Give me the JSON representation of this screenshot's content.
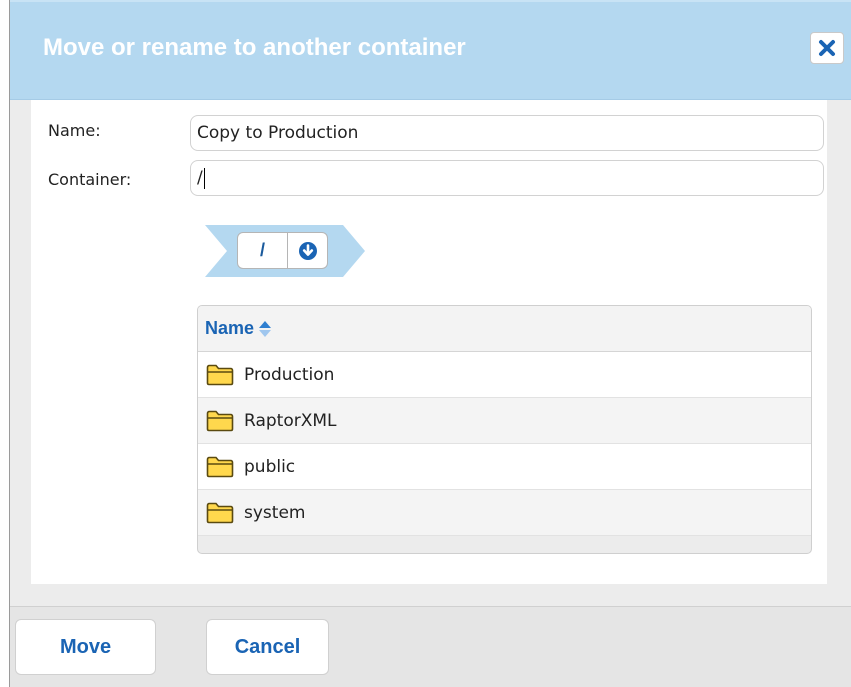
{
  "dialog": {
    "title": "Move or rename to another container",
    "close_icon": "close-icon",
    "accent_color": "#1a64b4",
    "titlebar_color": "#b4d8f0"
  },
  "form": {
    "name_label": "Name:",
    "name_value": "Copy to Production",
    "container_label": "Container:",
    "container_value": "/"
  },
  "breadcrumb": {
    "segment": "/",
    "dropdown_icon": "arrow-down-circle-icon"
  },
  "table": {
    "header": "Name",
    "sort_icon": "sort-icon",
    "rows": [
      {
        "label": "Production",
        "icon": "folder-icon"
      },
      {
        "label": "RaptorXML",
        "icon": "folder-icon"
      },
      {
        "label": "public",
        "icon": "folder-icon"
      },
      {
        "label": "system",
        "icon": "folder-icon"
      }
    ]
  },
  "footer": {
    "move_label": "Move",
    "cancel_label": "Cancel"
  }
}
